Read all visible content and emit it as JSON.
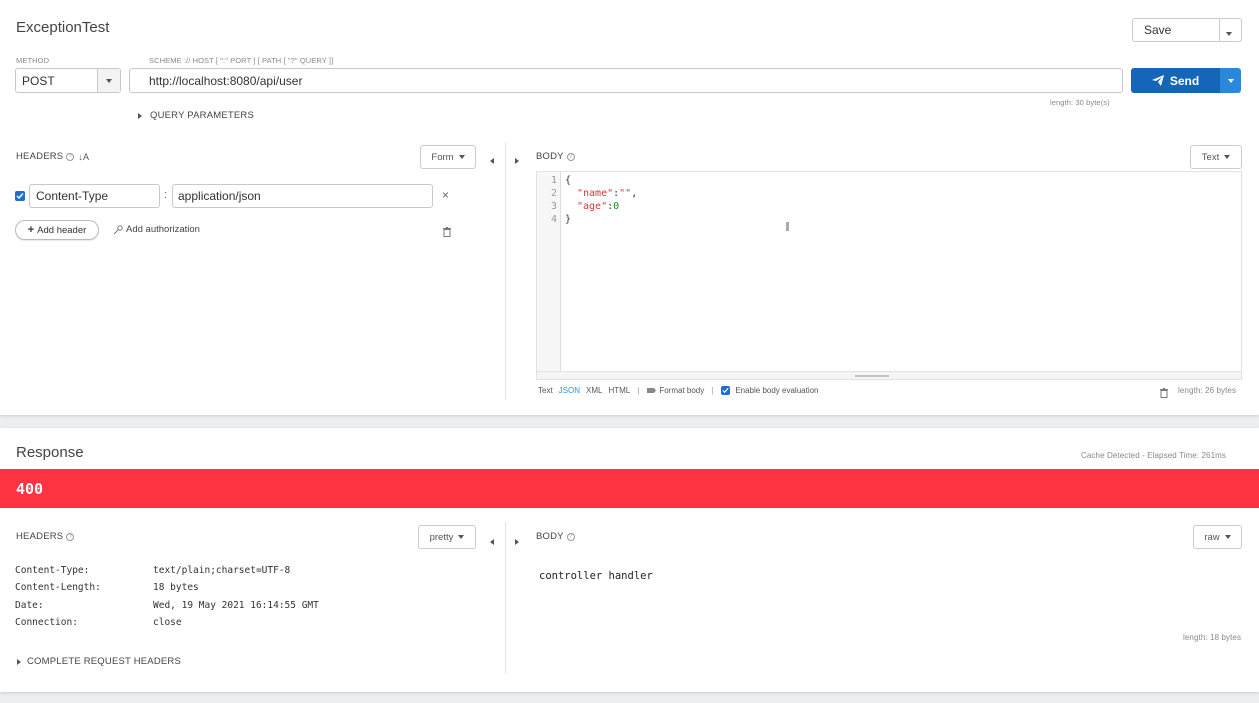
{
  "request": {
    "title": "ExceptionTest",
    "save_label": "Save",
    "method_label": "METHOD",
    "method_value": "POST",
    "url_label": "SCHEME :// HOST [ \":\" PORT ] [ PATH [ \"?\" QUERY ]]",
    "url_value": "http://localhost:8080/api/user",
    "send_label": "Send",
    "url_length": "length: 30 byte(s)",
    "query_params_label": "QUERY PARAMETERS",
    "headers_label": "HEADERS",
    "form_label": "Form",
    "headers": [
      {
        "name": "Content-Type",
        "value": "application/json",
        "enabled": true
      }
    ],
    "add_header_label": "Add header",
    "add_auth_label": "Add authorization",
    "body_label": "BODY",
    "body_mode_label": "Text",
    "body_lines": [
      {
        "num": "1",
        "text": "{"
      },
      {
        "num": "2",
        "key": "\"name\"",
        "sep": ":",
        "val": "\"\"",
        "tail": ","
      },
      {
        "num": "3",
        "key": "\"age\"",
        "sep": ":",
        "val": "0",
        "tail": ""
      },
      {
        "num": "4",
        "text": "}"
      }
    ],
    "body_formats": [
      "Text",
      "JSON",
      "XML",
      "HTML"
    ],
    "format_body_label": "Format body",
    "enable_eval_label": "Enable body evaluation",
    "body_length": "length: 26 bytes"
  },
  "response": {
    "title": "Response",
    "meta": "Cache Detected - Elapsed Time: 261ms",
    "status_code": "400",
    "status_color": "#ff3341",
    "headers_label": "HEADERS",
    "pretty_label": "pretty",
    "headers": [
      {
        "name": "Content-Type:",
        "value": "text/plain;charset=UTF-8"
      },
      {
        "name": "Content-Length:",
        "value": "18 bytes"
      },
      {
        "name": "Date:",
        "value": "Wed, 19 May 2021 16:14:55 GMT"
      },
      {
        "name": "Connection:",
        "value": "close"
      }
    ],
    "complete_headers_label": "COMPLETE REQUEST HEADERS",
    "body_label": "BODY",
    "raw_label": "raw",
    "body_text": "controller handler",
    "body_length": "length: 18 bytes"
  },
  "colors": {
    "accent": "#1565b8",
    "link": "#2196f3",
    "json_key": "#d23939",
    "json_num": "#1a8a1a"
  }
}
